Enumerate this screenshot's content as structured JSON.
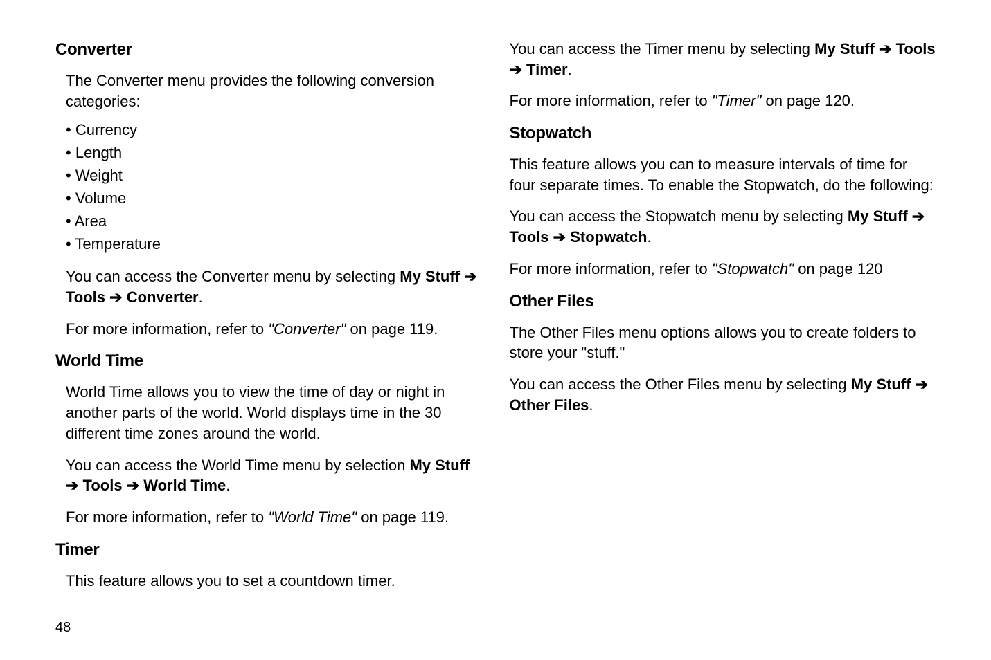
{
  "left": {
    "converter": {
      "heading": "Converter",
      "intro": "The Converter menu provides the following conversion categories:",
      "bullets": [
        "Currency",
        "Length",
        "Weight",
        "Volume",
        "Area",
        "Temperature"
      ],
      "access_pre": "You can access the Converter menu by selecting ",
      "access_path": [
        "My Stuff",
        "Tools",
        "Converter"
      ],
      "more_pre": "For more information, refer to ",
      "more_ref": "\"Converter\"",
      "more_post": " on page 119."
    },
    "worldtime": {
      "heading": "World Time",
      "intro": "World Time allows you to view the time of day or night in another parts of the world. World displays time in the 30 different time zones around the world.",
      "access_pre": "You can access the World Time menu by selection ",
      "access_path": [
        "My Stuff",
        "Tools",
        "World Time"
      ],
      "more_pre": "For more information, refer to ",
      "more_ref": "\"World Time\"",
      "more_post": " on page 119."
    },
    "timer": {
      "heading": "Timer",
      "intro": "This feature allows you to set a countdown timer."
    }
  },
  "right": {
    "timer_cont": {
      "access_pre": "You can access the Timer menu by selecting ",
      "access_path": [
        "My Stuff",
        "Tools",
        "Timer"
      ],
      "more_pre": "For more information, refer to ",
      "more_ref": "\"Timer\"",
      "more_post": " on page 120."
    },
    "stopwatch": {
      "heading": "Stopwatch",
      "intro": "This feature allows you can to measure intervals of time for four separate times. To enable the Stopwatch, do the following:",
      "access_pre": "You can access the Stopwatch menu by selecting ",
      "access_path": [
        "My Stuff",
        "Tools",
        "Stopwatch"
      ],
      "more_pre": "For more information, refer to ",
      "more_ref": "\"Stopwatch\"",
      "more_post": " on page 120"
    },
    "otherfiles": {
      "heading": "Other Files",
      "intro": "The Other Files menu options allows you to create folders to store your \"stuff.\"",
      "access_pre": "You can access the Other Files menu by selecting ",
      "access_path": [
        "My Stuff",
        "Other Files"
      ]
    }
  },
  "page_number": "48"
}
